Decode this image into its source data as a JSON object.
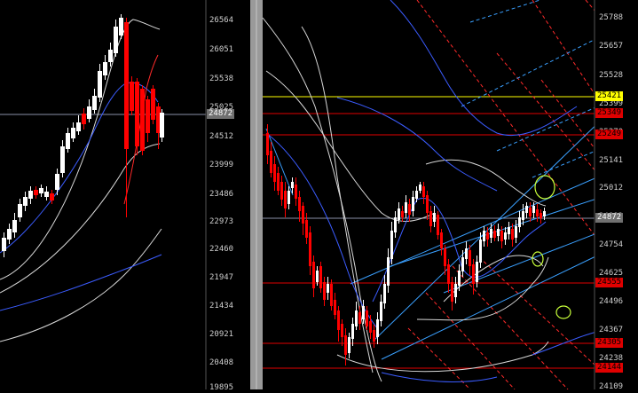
{
  "colors": {
    "background": "#000000",
    "splitter": "#9a9a9a",
    "bull_candle": "#ffffff",
    "bear_candle": "#ff0000",
    "axis_text": "#cfcfcf",
    "price_line": "#8a8fa8",
    "ma_blue": "#3b5cff",
    "bollinger": "#d8d8d8",
    "channel_blue": "#3aa0ff",
    "fan_red": "#ff2a2a",
    "level_yellow": "#ffff00",
    "level_red": "#e00000",
    "ellipse": "#c8ff3a"
  },
  "left_panel": {
    "axis_labels": [
      "26564",
      "26051",
      "25538",
      "25025",
      "24512",
      "23999",
      "23486",
      "22973",
      "22460",
      "21947",
      "21434",
      "20921",
      "20408",
      "19895"
    ],
    "current_price_tag": "24872"
  },
  "right_panel": {
    "axis_labels": [
      "25788",
      "25657",
      "25528",
      "25399",
      "25270",
      "25141",
      "25012",
      "24883",
      "24754",
      "24625",
      "24496",
      "24367",
      "24238",
      "24109"
    ],
    "current_price_tag": "24872",
    "level_tags": [
      {
        "text": "25421",
        "kind": "yellow"
      },
      {
        "text": "25349",
        "kind": "red"
      },
      {
        "text": "25249",
        "kind": "red"
      },
      {
        "text": "24555",
        "kind": "red"
      },
      {
        "text": "24305",
        "kind": "red"
      },
      {
        "text": "24144",
        "kind": "red"
      }
    ]
  }
}
